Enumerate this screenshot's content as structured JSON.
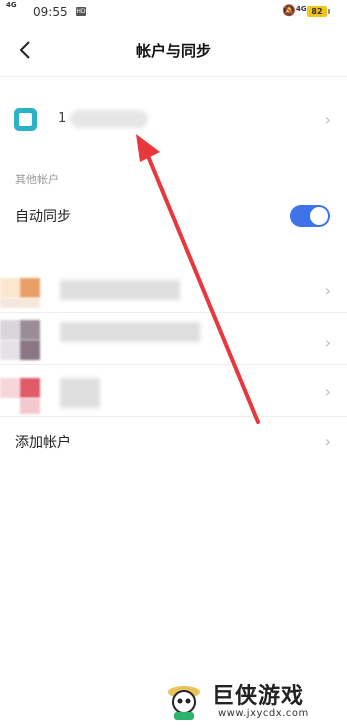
{
  "status_bar": {
    "signal": "4G",
    "time": "09:55",
    "hd_badge": "HD",
    "network": "4G",
    "battery": "82"
  },
  "nav": {
    "back_icon": "chevron-left-icon",
    "title": "帐户与同步"
  },
  "account": {
    "name_prefix": "1",
    "chevron": "›"
  },
  "section": {
    "other_accounts": "其他帐户"
  },
  "auto_sync": {
    "label": "自动同步",
    "enabled": true
  },
  "blurred_accounts": [
    {
      "chevron": "›"
    },
    {
      "chevron": "›"
    },
    {
      "chevron": "›"
    }
  ],
  "add_account": {
    "label": "添加帐户",
    "chevron": "›"
  },
  "annotation": {
    "arrow_color": "#e8383d"
  },
  "watermark": {
    "brand": "巨侠游戏",
    "url": "www.jxycdx.com"
  },
  "colors": {
    "accent": "#3f73e8",
    "app_icon": "#2bb3c5"
  }
}
